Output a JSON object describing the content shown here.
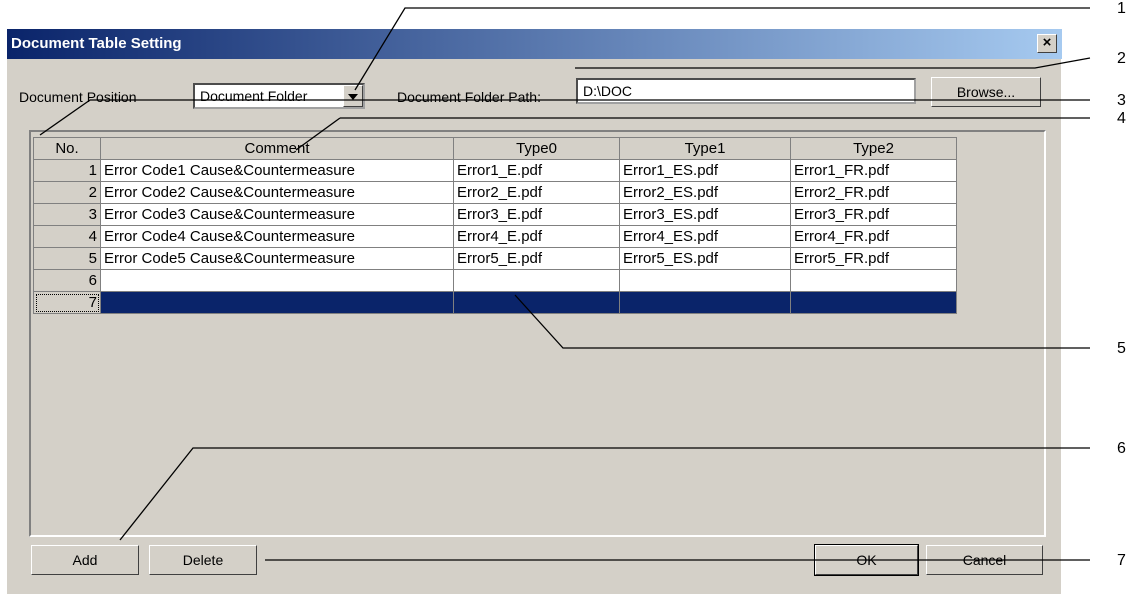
{
  "window": {
    "title": "Document Table Setting",
    "close_glyph": "×"
  },
  "form": {
    "doc_position_label": "Document Position",
    "doc_position_value": "Document Folder",
    "folder_path_label": "Document Folder Path:",
    "folder_path_value": "D:\\DOC",
    "browse_label": "Browse..."
  },
  "table": {
    "columns": [
      "No.",
      "Comment",
      "Type0",
      "Type1",
      "Type2"
    ],
    "rows": [
      {
        "no": "1",
        "comment": "Error Code1 Cause&Countermeasure",
        "type0": "Error1_E.pdf",
        "type1": "Error1_ES.pdf",
        "type2": "Error1_FR.pdf"
      },
      {
        "no": "2",
        "comment": "Error Code2 Cause&Countermeasure",
        "type0": "Error2_E.pdf",
        "type1": "Error2_ES.pdf",
        "type2": "Error2_FR.pdf"
      },
      {
        "no": "3",
        "comment": "Error Code3 Cause&Countermeasure",
        "type0": "Error3_E.pdf",
        "type1": "Error3_ES.pdf",
        "type2": "Error3_FR.pdf"
      },
      {
        "no": "4",
        "comment": "Error Code4 Cause&Countermeasure",
        "type0": "Error4_E.pdf",
        "type1": "Error4_ES.pdf",
        "type2": "Error4_FR.pdf"
      },
      {
        "no": "5",
        "comment": "Error Code5 Cause&Countermeasure",
        "type0": "Error5_E.pdf",
        "type1": "Error5_ES.pdf",
        "type2": "Error5_FR.pdf"
      },
      {
        "no": "6",
        "comment": "",
        "type0": "",
        "type1": "",
        "type2": ""
      },
      {
        "no": "7",
        "comment": "",
        "type0": "",
        "type1": "",
        "type2": ""
      }
    ],
    "selected_row": "7",
    "selection_color": "#0a246a"
  },
  "buttons": {
    "add": "Add",
    "delete": "Delete",
    "ok": "OK",
    "cancel": "Cancel"
  },
  "callouts": [
    "1",
    "2",
    "3",
    "4",
    "5",
    "6",
    "7"
  ]
}
